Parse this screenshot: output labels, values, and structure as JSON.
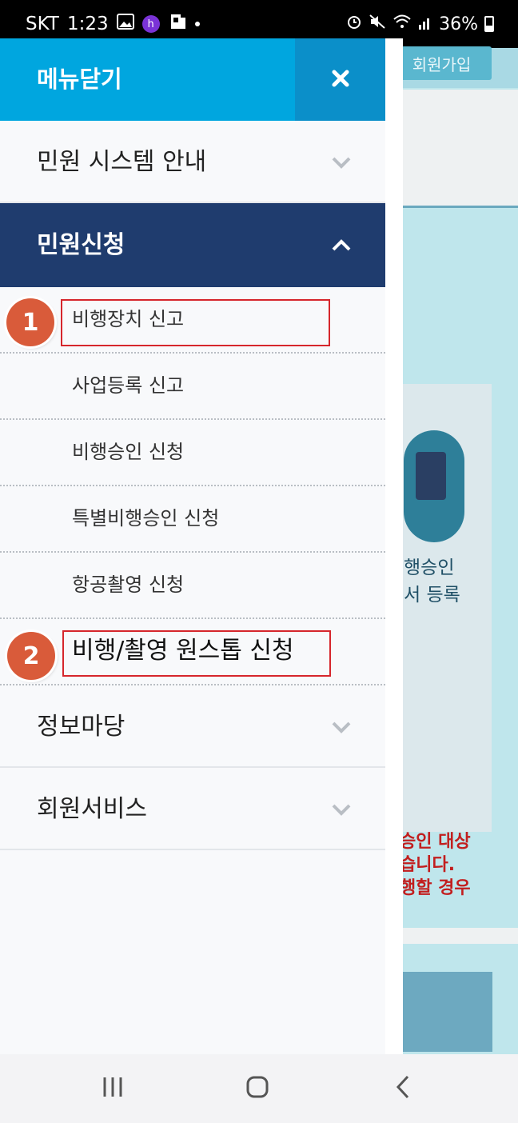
{
  "status_bar": {
    "carrier": "SKT",
    "time": "1:23",
    "battery": "36%",
    "icons": [
      "gallery-icon",
      "h-badge-icon",
      "sim-icon",
      "dot-icon",
      "alarm-icon",
      "mute-icon",
      "wifi-icon",
      "signal-icon",
      "battery-icon"
    ],
    "h_badge": "h"
  },
  "background_page": {
    "join_button": "회원가입",
    "card_text_line1": "행승인",
    "card_text_line2": "서 등록",
    "notice_line1": "승인 대상",
    "notice_line2": "습니다.",
    "notice_line3": "행할 경우"
  },
  "drawer": {
    "header_title": "메뉴닫기",
    "close_icon": "close-icon",
    "sections": [
      {
        "label": "민원 시스템 안내",
        "expanded": false
      },
      {
        "label": "민원신청",
        "expanded": true
      },
      {
        "label": "정보마당",
        "expanded": false
      },
      {
        "label": "회원서비스",
        "expanded": false
      }
    ],
    "sub_items": [
      {
        "label": "비행장치 신고"
      },
      {
        "label": "사업등록 신고"
      },
      {
        "label": "비행승인 신청"
      },
      {
        "label": "특별비행승인 신청"
      },
      {
        "label": "항공촬영 신청"
      },
      {
        "label": "비행/촬영 원스톱 신청"
      }
    ],
    "annotations": [
      {
        "number": "1"
      },
      {
        "number": "2"
      }
    ]
  },
  "colors": {
    "header_bg": "#00a6df",
    "close_bg": "#0b8fc9",
    "active_section_bg": "#1f3c6e",
    "highlight_border": "#d6262c",
    "badge_bg": "#d95b3a"
  }
}
